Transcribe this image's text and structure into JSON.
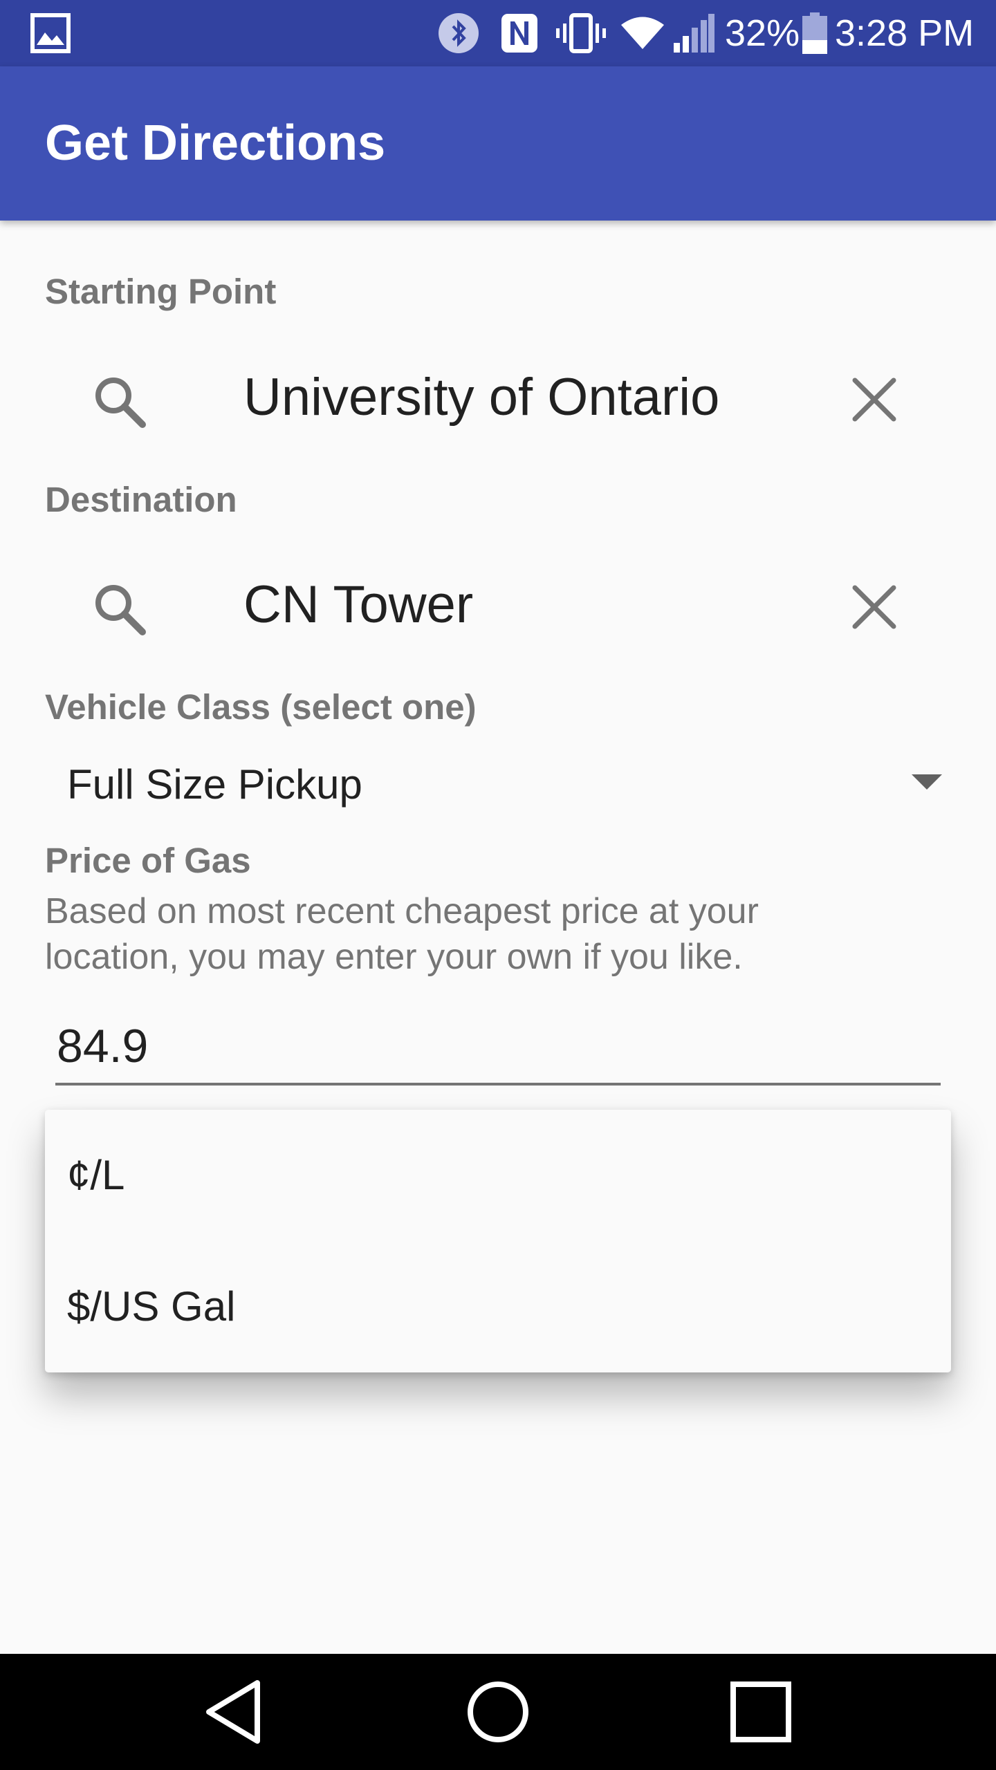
{
  "status_bar": {
    "battery_percent": "32%",
    "time": "3:28 PM",
    "icons": [
      "gallery-icon",
      "bluetooth-icon",
      "nfc-icon",
      "vibrate-icon",
      "wifi-icon",
      "signal-icon",
      "battery-icon"
    ]
  },
  "app_bar": {
    "title": "Get Directions",
    "color": "#3f51b5"
  },
  "form": {
    "starting_point": {
      "label": "Starting Point",
      "value": "University of Ontario"
    },
    "destination": {
      "label": "Destination",
      "value": "CN Tower"
    },
    "vehicle_class": {
      "label": "Vehicle Class (select one)",
      "selected": "Full Size Pickup"
    },
    "gas_price": {
      "label": "Price of Gas",
      "help": "Based on most recent cheapest price at your location, you may enter your own if you like.",
      "value": "84.9"
    }
  },
  "unit_dropdown": {
    "options": [
      "¢/L",
      "$/US Gal"
    ]
  },
  "nav_bar": {
    "buttons": [
      "back",
      "home",
      "recents"
    ]
  }
}
